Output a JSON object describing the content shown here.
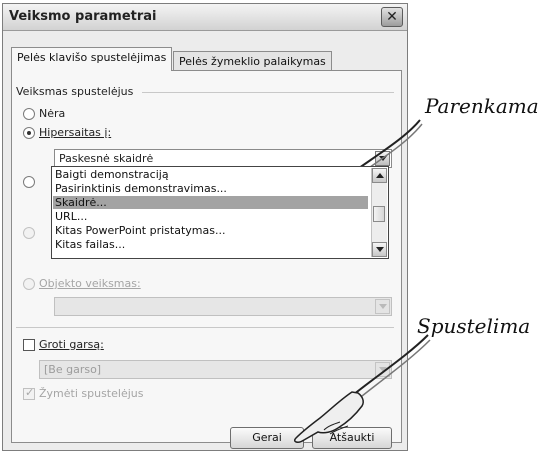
{
  "dialog": {
    "title": "Veiksmo parametrai",
    "close_glyph": "✕"
  },
  "tabs": [
    {
      "label": "Pelės klavišo spustelėjimas",
      "active": true
    },
    {
      "label": "Pelės žymeklio palaikymas",
      "active": false
    }
  ],
  "action_group": {
    "label": "Veiksmas spustelėjus",
    "options": [
      {
        "label": "Nėra",
        "selected": false
      },
      {
        "label": "Hipersaitas į:",
        "selected": true
      },
      {
        "label": "",
        "selected": false
      },
      {
        "label": "",
        "selected": false
      },
      {
        "label": "Objekto veiksmas:",
        "selected": false,
        "disabled": true
      }
    ],
    "hyperlink_value": "Paskesnė skaidrė",
    "dropdown_options": [
      "Baigti demonstraciją",
      "Pasirinktinis demonstravimas...",
      "Skaidrė...",
      "URL...",
      "Kitas PowerPoint pristatymas...",
      "Kitas failas..."
    ],
    "dropdown_selected_index": 2,
    "object_action_value": ""
  },
  "sound": {
    "label": "Groti garsą:",
    "checked": false,
    "value": "[Be garso]"
  },
  "highlight": {
    "label": "Žymėti spustelėjus",
    "checked": true,
    "disabled": true
  },
  "buttons": {
    "ok": "Gerai",
    "cancel": "Atšaukti"
  },
  "annotations": {
    "choose": "Parenkama",
    "click": "Spustelima"
  },
  "icons": {
    "close": "close-icon",
    "dropdown": "chevron-down-icon",
    "scroll_up": "scroll-up-icon",
    "scroll_down": "scroll-down-icon",
    "pointer_hand": "pointing-hand-icon"
  }
}
